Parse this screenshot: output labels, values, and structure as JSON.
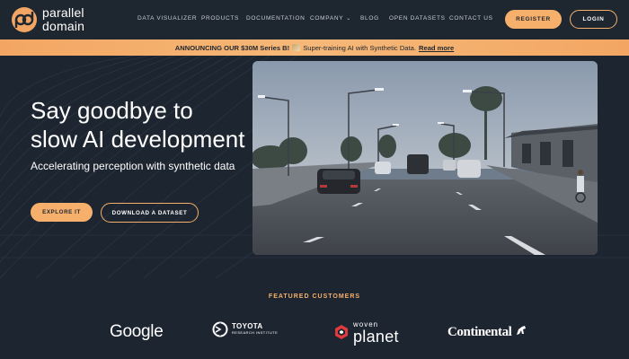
{
  "brand": {
    "name_line1": "parallel",
    "name_line2": "domain",
    "accent": "#f6b06c",
    "background": "#1d2530"
  },
  "nav": {
    "links": [
      {
        "label": "DATA VISUALIZER"
      },
      {
        "label": "PRODUCTS"
      },
      {
        "label": "DOCUMENTATION"
      },
      {
        "label": "COMPANY",
        "icon": "chevron-down-icon"
      },
      {
        "label": "BLOG"
      },
      {
        "label": "OPEN DATASETS"
      },
      {
        "label": "CONTACT US"
      }
    ],
    "register_label": "REGISTER",
    "login_label": "LOGIN"
  },
  "banner": {
    "bold_text": "ANNOUNCING OUR $30M Series B!",
    "body_text": "Super-training AI with Synthetic Data.",
    "link_text": "Read more",
    "icon": "flag-icon"
  },
  "hero": {
    "title_line1": "Say goodbye to",
    "title_line2": "slow AI development",
    "subtitle": "Accelerating perception with synthetic data",
    "explore_label": "EXPLORE IT",
    "download_label": "DOWNLOAD A DATASET",
    "image": "synthetic street scene with cars and street lights"
  },
  "customers": {
    "heading": "FEATURED CUSTOMERS",
    "google": "Google",
    "toyota_main": "TOYOTA",
    "toyota_sub": "RESEARCH INSTITUTE",
    "woven_top": "woven",
    "woven_bottom": "planet",
    "continental": "Continental"
  }
}
